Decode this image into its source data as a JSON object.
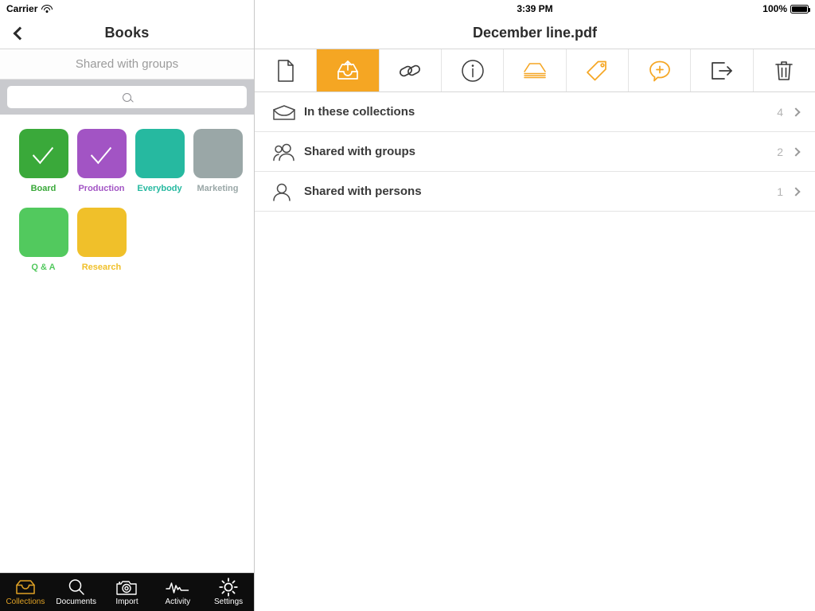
{
  "status_bar": {
    "carrier": "Carrier",
    "wifi_icon": "wifi-icon",
    "time": "3:39 PM",
    "battery_percent": "100%",
    "battery_icon": "battery-full-icon"
  },
  "left_panel": {
    "back_icon": "chevron-left-icon",
    "title": "Books",
    "scope_label": "Shared with groups",
    "search": {
      "placeholder": "",
      "value": "",
      "icon": "search-icon"
    },
    "tiles": [
      {
        "label": "Board",
        "color": "#3aa93a",
        "text_color": "#3aa93a",
        "selected": true
      },
      {
        "label": "Production",
        "color": "#a254c4",
        "text_color": "#a254c4",
        "selected": true
      },
      {
        "label": "Everybody",
        "color": "#26b9a0",
        "text_color": "#26b9a0",
        "selected": false
      },
      {
        "label": "Marketing",
        "color": "#9aa7a7",
        "text_color": "#9aa7a7",
        "selected": false
      },
      {
        "label": "Q & A",
        "color": "#52c95e",
        "text_color": "#52c95e",
        "selected": false
      },
      {
        "label": "Research",
        "color": "#f0c02a",
        "text_color": "#f0c02a",
        "selected": false
      }
    ],
    "tabs": [
      {
        "label": "Collections",
        "icon": "collections-tray-icon",
        "active": true
      },
      {
        "label": "Documents",
        "icon": "search-icon",
        "active": false
      },
      {
        "label": "Import",
        "icon": "camera-icon",
        "active": false
      },
      {
        "label": "Activity",
        "icon": "activity-waveform-icon",
        "active": false
      },
      {
        "label": "Settings",
        "icon": "gear-icon",
        "active": false
      }
    ]
  },
  "right_panel": {
    "document_title": "December line.pdf",
    "toolbar": [
      {
        "icon": "document-page-icon",
        "name": "document",
        "active": false
      },
      {
        "icon": "outbox-upload-icon",
        "name": "share",
        "active": true
      },
      {
        "icon": "link-chain-icon",
        "name": "link",
        "active": false
      },
      {
        "icon": "info-circle-icon",
        "name": "info",
        "active": false
      },
      {
        "icon": "collection-stack-icon",
        "name": "collection",
        "active": false
      },
      {
        "icon": "tag-icon",
        "name": "tag",
        "active": false
      },
      {
        "icon": "add-comment-icon",
        "name": "annotate",
        "active": false
      },
      {
        "icon": "export-arrow-icon",
        "name": "export",
        "active": false
      },
      {
        "icon": "trash-icon",
        "name": "delete",
        "active": false
      }
    ],
    "rows": [
      {
        "icon": "envelope-open-icon",
        "label": "In these collections",
        "count": "4",
        "chevron": "chevron-right-icon"
      },
      {
        "icon": "two-persons-icon",
        "label": "Shared with groups",
        "count": "2",
        "chevron": "chevron-right-icon"
      },
      {
        "icon": "person-icon",
        "label": "Shared with persons",
        "count": "1",
        "chevron": "chevron-right-icon"
      }
    ]
  },
  "colors": {
    "accent_orange": "#f5a623",
    "tab_active": "#e0a225",
    "tabbar_bg": "#0d0d0d",
    "search_band": "#c9cace"
  }
}
